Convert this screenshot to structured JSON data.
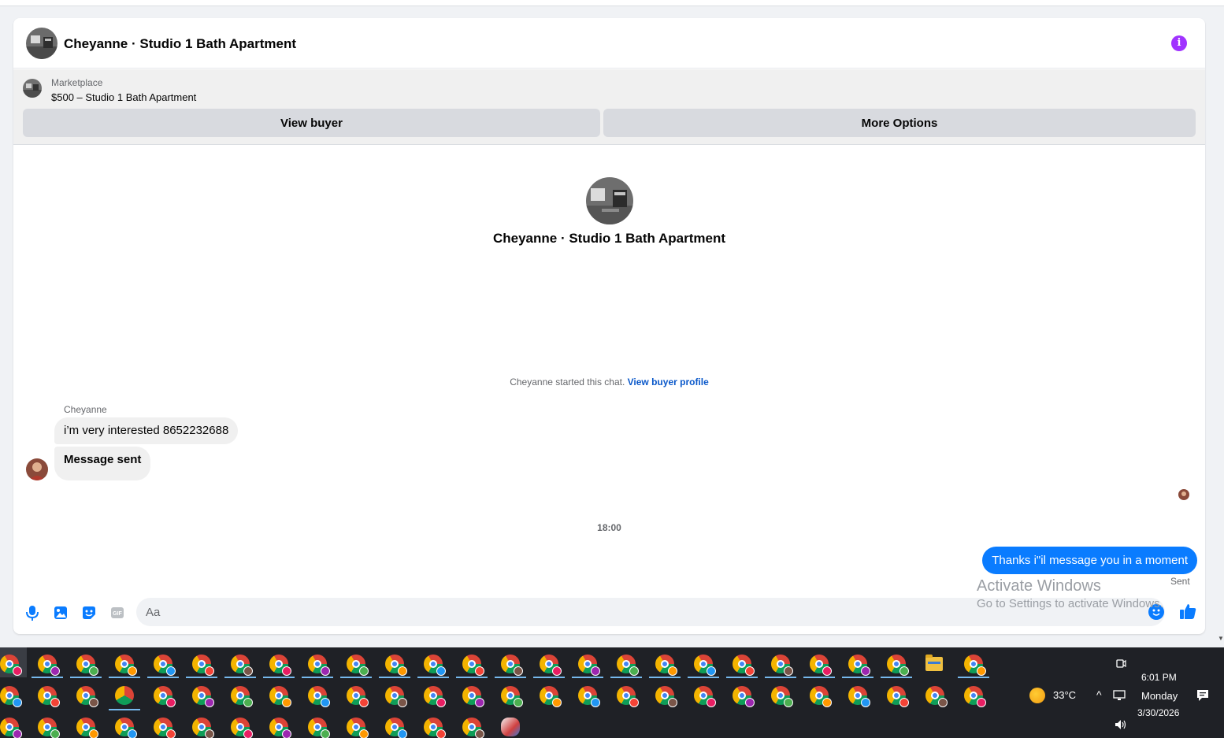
{
  "chat": {
    "title": "Cheyanne · Studio 1 Bath Apartment",
    "info_icon": "info-icon"
  },
  "marketplace": {
    "label": "Marketplace",
    "item": "$500 – Studio 1 Bath Apartment",
    "view_buyer": "View buyer",
    "more_options": "More Options"
  },
  "thread": {
    "title": "Cheyanne · Studio 1 Bath Apartment",
    "started_text": "Cheyanne started this chat.",
    "view_profile": "View buyer profile",
    "sender_name": "Cheyanne",
    "incoming": [
      "i’m very interested 8652232688",
      "Message sent"
    ],
    "timestamp": "18:00",
    "outgoing": "Thanks i\"il message you in a moment",
    "status": "Sent"
  },
  "composer": {
    "placeholder": "Aa",
    "tools": [
      "microphone-icon",
      "photo-icon",
      "sticker-icon",
      "gif-icon"
    ],
    "gif_label": "GIF"
  },
  "watermark": {
    "line1": "Activate Windows",
    "line2": "Go to Settings to activate Windows."
  },
  "taskbar": {
    "weather": "33°C",
    "time": "6:01 PM",
    "day": "Monday",
    "date": "3/30/2026"
  },
  "colors": {
    "accent": "#0a7cff",
    "info": "#a033ff",
    "link": "#0a58ca"
  }
}
